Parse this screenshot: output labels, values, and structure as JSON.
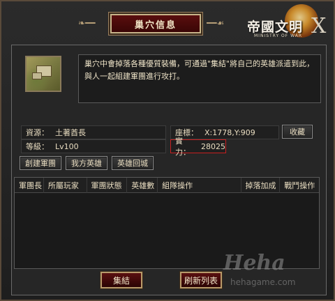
{
  "window": {
    "title": "巢穴信息"
  },
  "logo": {
    "title": "帝國文明",
    "subtitle": "MINISTRY OF WAR"
  },
  "intro": {
    "description": "巢穴中會掉落各種優質裝備，可通過\"集結\"將自己的英雄派遣到此，與人一起組建軍團進行攻打。"
  },
  "info": {
    "source_label": "資源：",
    "source_value": "土著酋長",
    "level_label": "等級：",
    "level_value": "Lv100",
    "coord_label": "座標：",
    "coord_value": "X:1778,Y:909",
    "power_label": "實力：",
    "power_value": "28025",
    "collect_button": "收藏"
  },
  "actions": {
    "create_legion": "創建軍團",
    "my_hero": "我方英雄",
    "hero_return": "英雄回城"
  },
  "table": {
    "headers": [
      "軍團長",
      "所屬玩家",
      "軍團狀態",
      "英雄數",
      "組隊操作",
      "掉落加成",
      "戰鬥操作"
    ],
    "rows": []
  },
  "footer": {
    "gather_button": "集結",
    "refresh_button": "刷新列表"
  },
  "watermark": {
    "big": "Heha",
    "small": "hehagame.com"
  }
}
